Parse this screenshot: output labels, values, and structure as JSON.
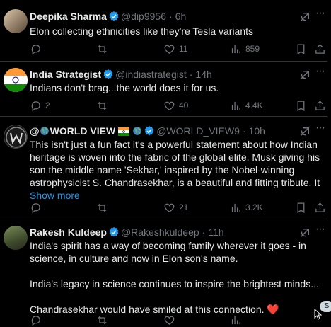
{
  "colors": {
    "background": "#000000",
    "text": "#e7e9ea",
    "muted": "#71767b",
    "accent": "#1d9bf0",
    "verified": "#1d9bf0",
    "divider": "#2f3336"
  },
  "tweets": [
    {
      "name": "Deepika Sharma",
      "handle": "@dip9956",
      "time": "6h",
      "text": [
        "Elon collecting ethnicities like they're Tesla variants"
      ],
      "replies": "",
      "retweets": "",
      "likes": "11",
      "views": "859"
    },
    {
      "name": "India Strategist",
      "handle": "@indiastrategist",
      "time": "14h",
      "text": [
        "Indians don't brag...the world does it for us."
      ],
      "replies": "2",
      "retweets": "",
      "likes": "40",
      "views": "4.4K"
    },
    {
      "name_prefix": "@",
      "name_main": "WORLD VIEW",
      "handle": "@WORLD_VIEW9",
      "time": "10h",
      "text": [
        "This isn't just a fun fact it's a powerful statement about how Indian heritage is woven into the fabric of the global elite. Musk giving his son the middle name 'Sekhar,' inspired by the Nobel-winning astrophysicist S. Chandrasekhar, is a beautiful and fitting tribute. It"
      ],
      "show_more": "Show more",
      "replies": "",
      "retweets": "",
      "likes": "21",
      "views": "3.2K"
    },
    {
      "name": "Rakesh Kuldeep",
      "handle": "@Rakeshkuldeep",
      "time": "11h",
      "text": [
        "India's spirit has a way of becoming family wherever it goes -  in science, in culture and now in Elon son's name.",
        "India's legacy in science continues to inspire the brightest minds...",
        "Chandrasekhar would have  smiled at this connection."
      ],
      "heart_emoji": "❤️"
    }
  ],
  "separator": "·",
  "more_glyph": "···",
  "scroll_label": "S"
}
